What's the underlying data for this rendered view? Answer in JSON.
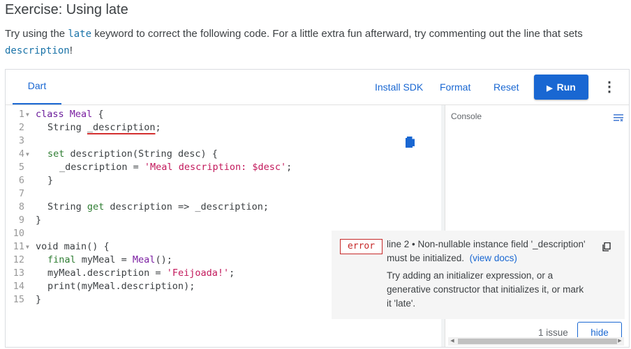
{
  "page": {
    "title": "Exercise: Using late",
    "intro_pre": "Try using the ",
    "intro_kw1": "late",
    "intro_mid": " keyword to correct the following code. For a little extra fun afterward, try commenting out the line that sets ",
    "intro_kw2": "description",
    "intro_end": "!"
  },
  "toolbar": {
    "tab": "Dart",
    "install_sdk": "Install SDK",
    "format": "Format",
    "reset": "Reset",
    "run": "Run",
    "more": "⋮"
  },
  "editor": {
    "line_numbers": [
      "1",
      "2",
      "3",
      "4",
      "5",
      "6",
      "7",
      "8",
      "9",
      "10",
      "11",
      "12",
      "13",
      "14",
      "15"
    ],
    "code": {
      "l1_kw": "class",
      "l1_type": "Meal",
      "l1_rest": " {",
      "l2_type": "String",
      "l2_sp": " ",
      "l2_field": "_description",
      "l2_end": ";",
      "l4_kw": "set",
      "l4_rest": " description(String desc) {",
      "l5_pre": "_description = ",
      "l5_str": "'Meal description: $desc'",
      "l5_end": ";",
      "l6": "}",
      "l8_type": "String",
      "l8_kw": " get",
      "l8_rest": " description => _description;",
      "l9": "}",
      "l11": "void main() {",
      "l12_kw": "final",
      "l12_mid": " myMeal = ",
      "l12_type": "Meal",
      "l12_end": "();",
      "l13_pre": "myMeal.description = ",
      "l13_str": "'Feijoada!'",
      "l13_end": ";",
      "l14": "print(myMeal.description);",
      "l15": "}"
    }
  },
  "console": {
    "label": "Console"
  },
  "issue": {
    "severity": "error",
    "message": "line 2 • Non-nullable instance field '_description' must be initialized.",
    "docs_link": "(view docs)",
    "hint": "Try adding an initializer expression, or a generative constructor that initializes it, or mark it 'late'."
  },
  "footer": {
    "issue_count": "1 issue",
    "hide": "hide"
  },
  "colors": {
    "accent": "#1967d2",
    "error": "#c62828",
    "string": "#c2185b",
    "keyword": "#6a1b9a"
  }
}
